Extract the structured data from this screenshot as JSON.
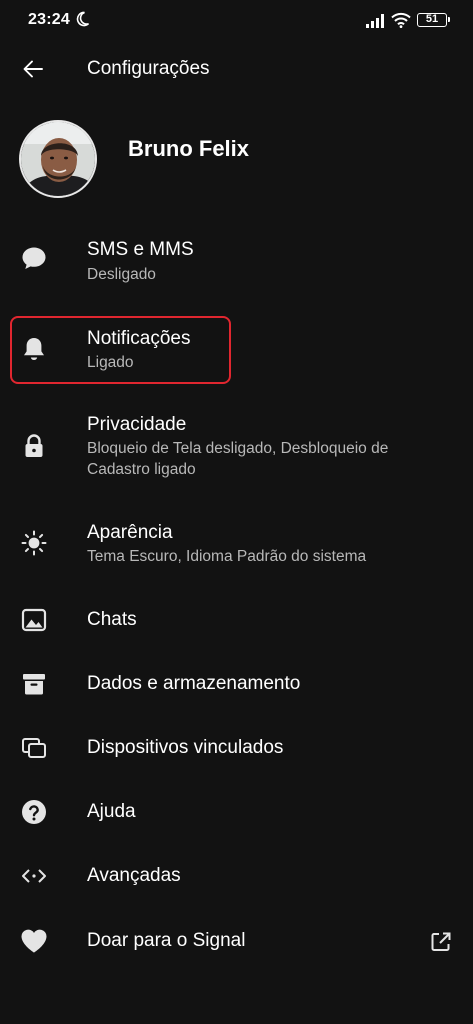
{
  "status_bar": {
    "time": "23:24",
    "battery": "51",
    "icons": [
      "moon-icon",
      "signal-icon",
      "wifi-icon",
      "battery-icon"
    ]
  },
  "header": {
    "title": "Configurações",
    "back_icon": "arrow-left-icon"
  },
  "profile": {
    "name": "Bruno Felix"
  },
  "settings": {
    "sms": {
      "title": "SMS e MMS",
      "subtitle": "Desligado",
      "icon": "chat-bubble-icon"
    },
    "notifications": {
      "title": "Notificações",
      "subtitle": "Ligado",
      "icon": "bell-icon"
    },
    "privacy": {
      "title": "Privacidade",
      "subtitle": "Bloqueio de Tela desligado, Desbloqueio de Cadastro ligado",
      "icon": "lock-icon"
    },
    "appearance": {
      "title": "Aparência",
      "subtitle": "Tema Escuro, Idioma Padrão do sistema",
      "icon": "sun-icon"
    },
    "chats": {
      "title": "Chats",
      "icon": "image-icon"
    },
    "data": {
      "title": "Dados e armazenamento",
      "icon": "archive-icon"
    },
    "devices": {
      "title": "Dispositivos vinculados",
      "icon": "devices-icon"
    },
    "help": {
      "title": "Ajuda",
      "icon": "help-icon"
    },
    "advanced": {
      "title": "Avançadas",
      "icon": "code-icon"
    },
    "donate": {
      "title": "Doar para o Signal",
      "icon": "heart-icon",
      "trailing_icon": "external-link-icon"
    }
  },
  "colors": {
    "background": "#121212",
    "text_primary": "#ffffff",
    "text_secondary": "#b8b8b8",
    "highlight_border": "#e0262f"
  }
}
